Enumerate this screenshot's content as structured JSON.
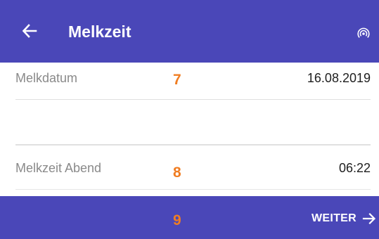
{
  "appbar": {
    "title": "Melkzeit",
    "back_icon": "arrow-left-icon",
    "network_icon": "wifi-tethering-icon",
    "color": "#4a47b8"
  },
  "fields": {
    "date": {
      "label": "Melkdatum",
      "value": "16.08.2019"
    },
    "time": {
      "label": "Melkzeit Abend",
      "value": "06:22"
    }
  },
  "annotations": {
    "marker_1": "7",
    "marker_2": "8",
    "marker_3": "9",
    "color": "#f07d22"
  },
  "footer": {
    "next_label": "WEITER",
    "next_icon": "arrow-right-icon"
  }
}
